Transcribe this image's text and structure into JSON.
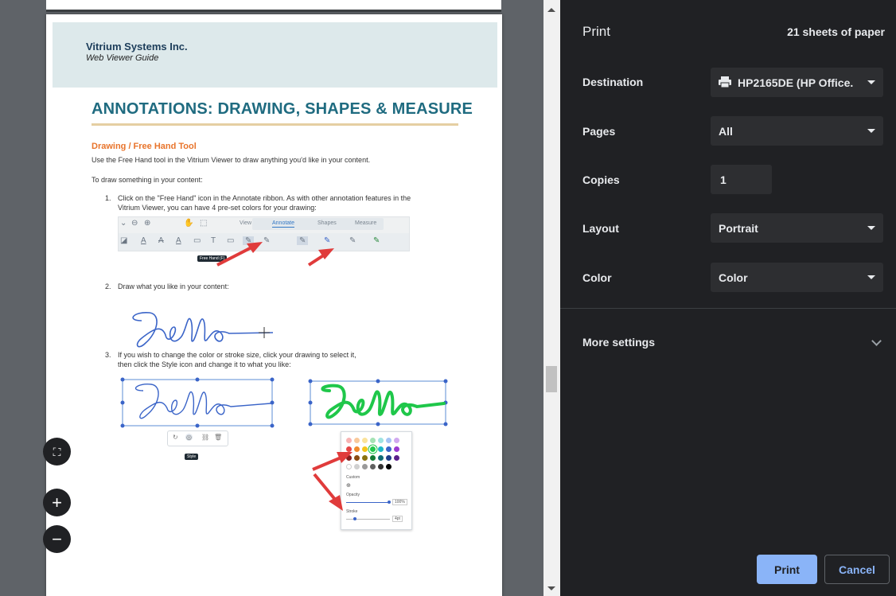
{
  "document": {
    "company": "Vitrium Systems Inc.",
    "guide": "Web Viewer Guide",
    "section_title": "ANNOTATIONS: DRAWING, SHAPES & MEASURE",
    "subheading": "Drawing / Free Hand Tool",
    "intro": "Use the Free Hand tool in the Vitrium Viewer to draw anything you'd like in your content.",
    "instruction": "To draw something in your content:",
    "steps": [
      {
        "num": "1.",
        "line1": "Click on the \"Free Hand\" icon in the Annotate ribbon. As with other annotation features in the",
        "line2": "Vitrium Viewer, you can have 4 pre-set colors for your drawing:"
      },
      {
        "num": "2.",
        "line1": "Draw what you like in your content:",
        "line2": ""
      },
      {
        "num": "3.",
        "line1": "If you wish to change the color or stroke size, click your drawing to select it,",
        "line2": "then click the Style icon and change it to what you like:"
      }
    ],
    "ribbon_tabs": [
      "View",
      "Annotate",
      "Shapes",
      "Measure"
    ],
    "ribbon_active_tab": "Annotate",
    "tooltip_freehand": "Free Hand (F)",
    "tooltip_style": "Style",
    "style_panel": {
      "custom_label": "Custom",
      "opacity_label": "Opacity",
      "opacity_value": "100%",
      "stroke_label": "Stroke",
      "stroke_value": "4pt"
    },
    "ink_colors": {
      "blue": "#3a64c8",
      "green": "#1fc74a"
    }
  },
  "zoom_controls": {
    "fit_icon": "fit-to-page-icon",
    "zoom_in_icon": "zoom-in-icon",
    "zoom_out_icon": "zoom-out-icon"
  },
  "print_panel": {
    "title": "Print",
    "sheets": "21 sheets of paper",
    "destination_label": "Destination",
    "destination_value": "HP2165DE (HP Office.",
    "pages_label": "Pages",
    "pages_value": "All",
    "copies_label": "Copies",
    "copies_value": "1",
    "layout_label": "Layout",
    "layout_value": "Portrait",
    "color_label": "Color",
    "color_value": "Color",
    "more_settings_label": "More settings",
    "print_button": "Print",
    "cancel_button": "Cancel"
  },
  "colors": {
    "panel_bg": "#202124",
    "select_bg": "#2d2e31",
    "accent": "#8ab4f8",
    "title_teal": "#1f6b80",
    "subhead_orange": "#e8742b"
  }
}
